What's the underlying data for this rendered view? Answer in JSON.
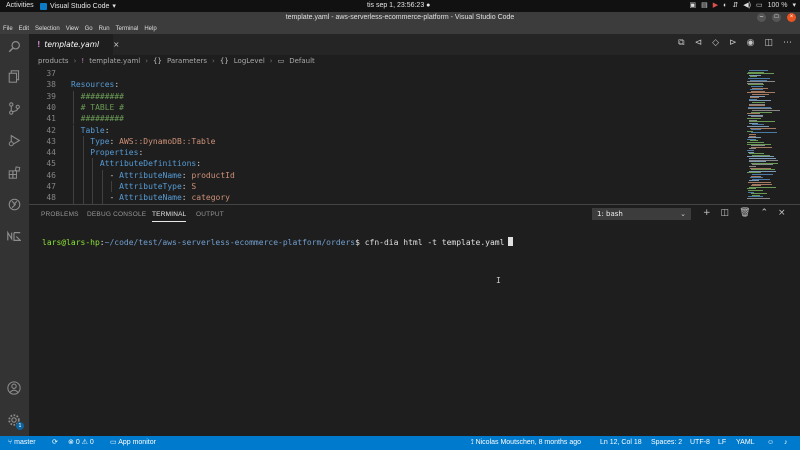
{
  "topbar": {
    "activities": "Activities",
    "app_name": "Visual Studio Code",
    "clock": "tis sep  1, 23:56:23 ●",
    "battery": "100 %"
  },
  "window": {
    "title": "template.yaml - aws-serverless-ecommerce-platform - Visual Studio Code"
  },
  "menu": [
    "File",
    "Edit",
    "Selection",
    "View",
    "Go",
    "Run",
    "Terminal",
    "Help"
  ],
  "activity_bar": {
    "icons": [
      "explorer-icon",
      "search-icon",
      "source-control-icon",
      "run-debug-icon",
      "extensions-icon",
      "remote-explorer-icon",
      "aws-icon"
    ],
    "account_icon": "account-icon",
    "settings_badge": "1"
  },
  "editor": {
    "tab_label": "template.yaml",
    "tab_icon": "!",
    "breadcrumb": [
      "products",
      "template.yaml",
      "Parameters",
      "LogLevel",
      "Default"
    ],
    "lines": [
      {
        "n": "37",
        "parts": []
      },
      {
        "n": "38",
        "parts": [
          {
            "t": "Resources",
            "c": "k"
          },
          {
            "t": ":",
            "c": "p"
          }
        ]
      },
      {
        "n": "39",
        "parts": [
          {
            "t": "  #########",
            "c": "c"
          }
        ]
      },
      {
        "n": "40",
        "parts": [
          {
            "t": "  # TABLE #",
            "c": "c"
          }
        ]
      },
      {
        "n": "41",
        "parts": [
          {
            "t": "  #########",
            "c": "c"
          }
        ]
      },
      {
        "n": "42",
        "parts": [
          {
            "t": "  Table",
            "c": "k"
          },
          {
            "t": ":",
            "c": "p"
          }
        ]
      },
      {
        "n": "43",
        "parts": [
          {
            "t": "    Type",
            "c": "k"
          },
          {
            "t": ": ",
            "c": "p"
          },
          {
            "t": "AWS::DynamoDB::Table",
            "c": "s"
          }
        ]
      },
      {
        "n": "44",
        "parts": [
          {
            "t": "    Properties",
            "c": "k"
          },
          {
            "t": ":",
            "c": "p"
          }
        ]
      },
      {
        "n": "45",
        "parts": [
          {
            "t": "      AttributeDefinitions",
            "c": "k"
          },
          {
            "t": ":",
            "c": "p"
          }
        ]
      },
      {
        "n": "46",
        "parts": [
          {
            "t": "        - ",
            "c": "p"
          },
          {
            "t": "AttributeName",
            "c": "k"
          },
          {
            "t": ": ",
            "c": "p"
          },
          {
            "t": "productId",
            "c": "s"
          }
        ]
      },
      {
        "n": "47",
        "parts": [
          {
            "t": "          AttributeType",
            "c": "k"
          },
          {
            "t": ": ",
            "c": "p"
          },
          {
            "t": "S",
            "c": "s"
          }
        ]
      },
      {
        "n": "48",
        "parts": [
          {
            "t": "        - ",
            "c": "p"
          },
          {
            "t": "AttributeName",
            "c": "k"
          },
          {
            "t": ": ",
            "c": "p"
          },
          {
            "t": "category",
            "c": "s"
          }
        ]
      }
    ]
  },
  "panel": {
    "tabs": [
      "PROBLEMS",
      "DEBUG CONSOLE",
      "TERMINAL",
      "OUTPUT"
    ],
    "active_tab": "TERMINAL",
    "terminal_select": "1: bash"
  },
  "terminal": {
    "user_host": "lars@lars-hp",
    "path": "~/code/test/aws-serverless-ecommerce-platform/orders",
    "command": "cfn-dia html -t template.yaml"
  },
  "statusbar": {
    "branch": "master",
    "errors": "0",
    "warnings": "0",
    "app_monitor": "App monitor",
    "blame": "Nicolas Moutschen, 8 months ago",
    "cursor_pos": "Ln 12, Col 18",
    "spaces": "Spaces: 2",
    "encoding": "UTF-8",
    "eol": "LF",
    "language": "YAML"
  }
}
